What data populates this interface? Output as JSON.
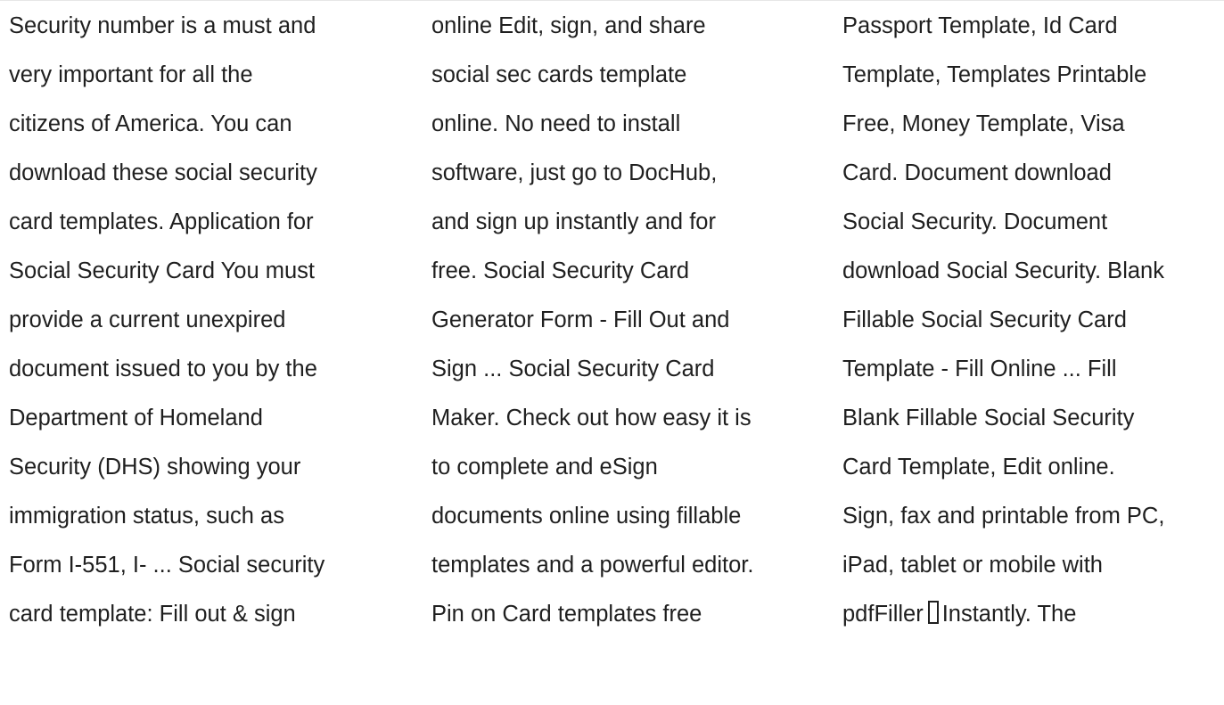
{
  "columns": [
    {
      "lines": [
        "Security number is a must and",
        "very important for all the",
        "citizens of America. You can",
        "download these social security",
        "card templates. Application for",
        "Social Security Card You must",
        "provide a current unexpired",
        "document issued to you by the",
        "Department of Homeland",
        "Security (DHS) showing your",
        "immigration status, such as",
        "Form I-551, I- ... Social security",
        "card template: Fill out & sign"
      ]
    },
    {
      "lines": [
        "online Edit, sign, and share",
        "social sec cards template",
        "online. No need to install",
        "software, just go to DocHub,",
        "and sign up instantly and for",
        "free. Social Security Card",
        "Generator Form - Fill Out and",
        "Sign ... Social Security Card",
        "Maker. Check out how easy it is",
        "to complete and eSign",
        "documents online using fillable",
        "templates and a powerful editor.",
        "Pin on Card templates free"
      ]
    },
    {
      "lines": [
        "Passport Template, Id Card",
        "Template, Templates Printable",
        "Free, Money Template, Visa",
        "Card. Document download",
        "Social Security. Document",
        "download Social Security. Blank",
        "Fillable Social Security Card",
        "Template - Fill Online ... Fill",
        "Blank Fillable Social Security",
        "Card Template, Edit online.",
        "Sign, fax and printable from PC,",
        "iPad, tablet or mobile with",
        "Instantly. The"
      ],
      "last_line_prefix": "pdfFiller",
      "missing_glyph_icon": "missing-glyph-box"
    }
  ]
}
